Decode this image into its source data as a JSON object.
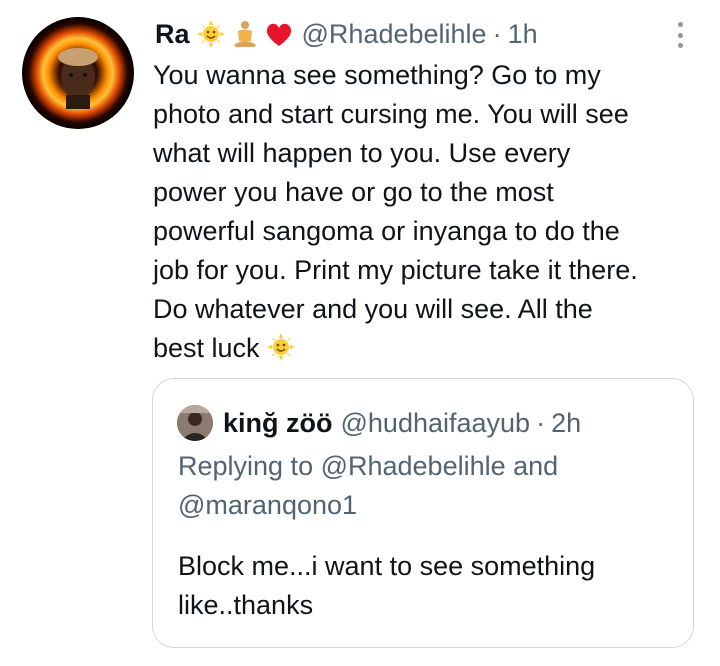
{
  "tweet": {
    "author_name": "Ra",
    "author_emojis": [
      "sun-emoji",
      "person-meditating-emoji",
      "red-heart-emoji"
    ],
    "handle": "@Rhadebelihle",
    "separator": "·",
    "time": "1h",
    "more_icon": "more-vertical-icon",
    "text_lines": [
      "You wanna see something? Go to my",
      "photo and start cursing me. You will see",
      "what will happen to you. Use every",
      "power you have or go to the most",
      "powerful sangoma or inyanga to do the",
      "job for you. Print my picture take it there.",
      "Do whatever and you will see. All the",
      "best luck"
    ],
    "trailing_emoji": "sun-emoji"
  },
  "quoted_tweet": {
    "author_name": "kinğ zöö",
    "handle": "@hudhaifaayub",
    "separator": "·",
    "time": "2h",
    "replying_lines": [
      "Replying to @Rhadebelihle and",
      "@maranqono1"
    ],
    "text_lines": [
      "Block me...i want to see something",
      "like..thanks"
    ]
  },
  "colors": {
    "text": "#0f1419",
    "secondary": "#536471",
    "border": "#cfd9de",
    "heart": "#f91880",
    "sun": "#ffcc33"
  }
}
